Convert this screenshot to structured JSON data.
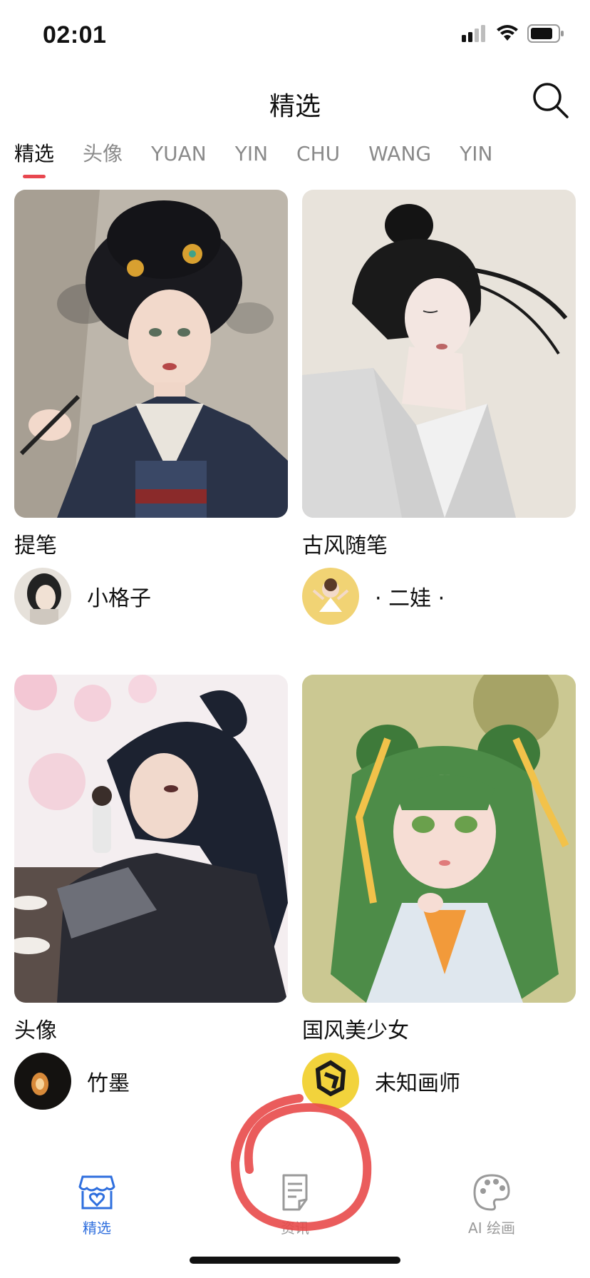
{
  "status": {
    "time": "02:01"
  },
  "header": {
    "title": "精选"
  },
  "tabs": [
    "精选",
    "头像",
    "YUAN",
    "YIN",
    "CHU",
    "WANG",
    "YIN"
  ],
  "cards": [
    {
      "title": "提笔",
      "author": "小格子"
    },
    {
      "title": "古风随笔",
      "author": "· 二娃 ·"
    },
    {
      "title": "头像",
      "author": "竹墨"
    },
    {
      "title": "国风美少女",
      "author": "未知画师"
    }
  ],
  "bottom_nav": [
    {
      "label": "精选",
      "icon": "store-heart-icon",
      "active": true
    },
    {
      "label": "资讯",
      "icon": "document-icon",
      "active": false
    },
    {
      "label": "AI 绘画",
      "icon": "palette-icon",
      "active": false
    }
  ],
  "colors": {
    "accent": "#e8474f",
    "nav_active": "#2f6fde",
    "nav_inactive": "#9a9a9a"
  }
}
